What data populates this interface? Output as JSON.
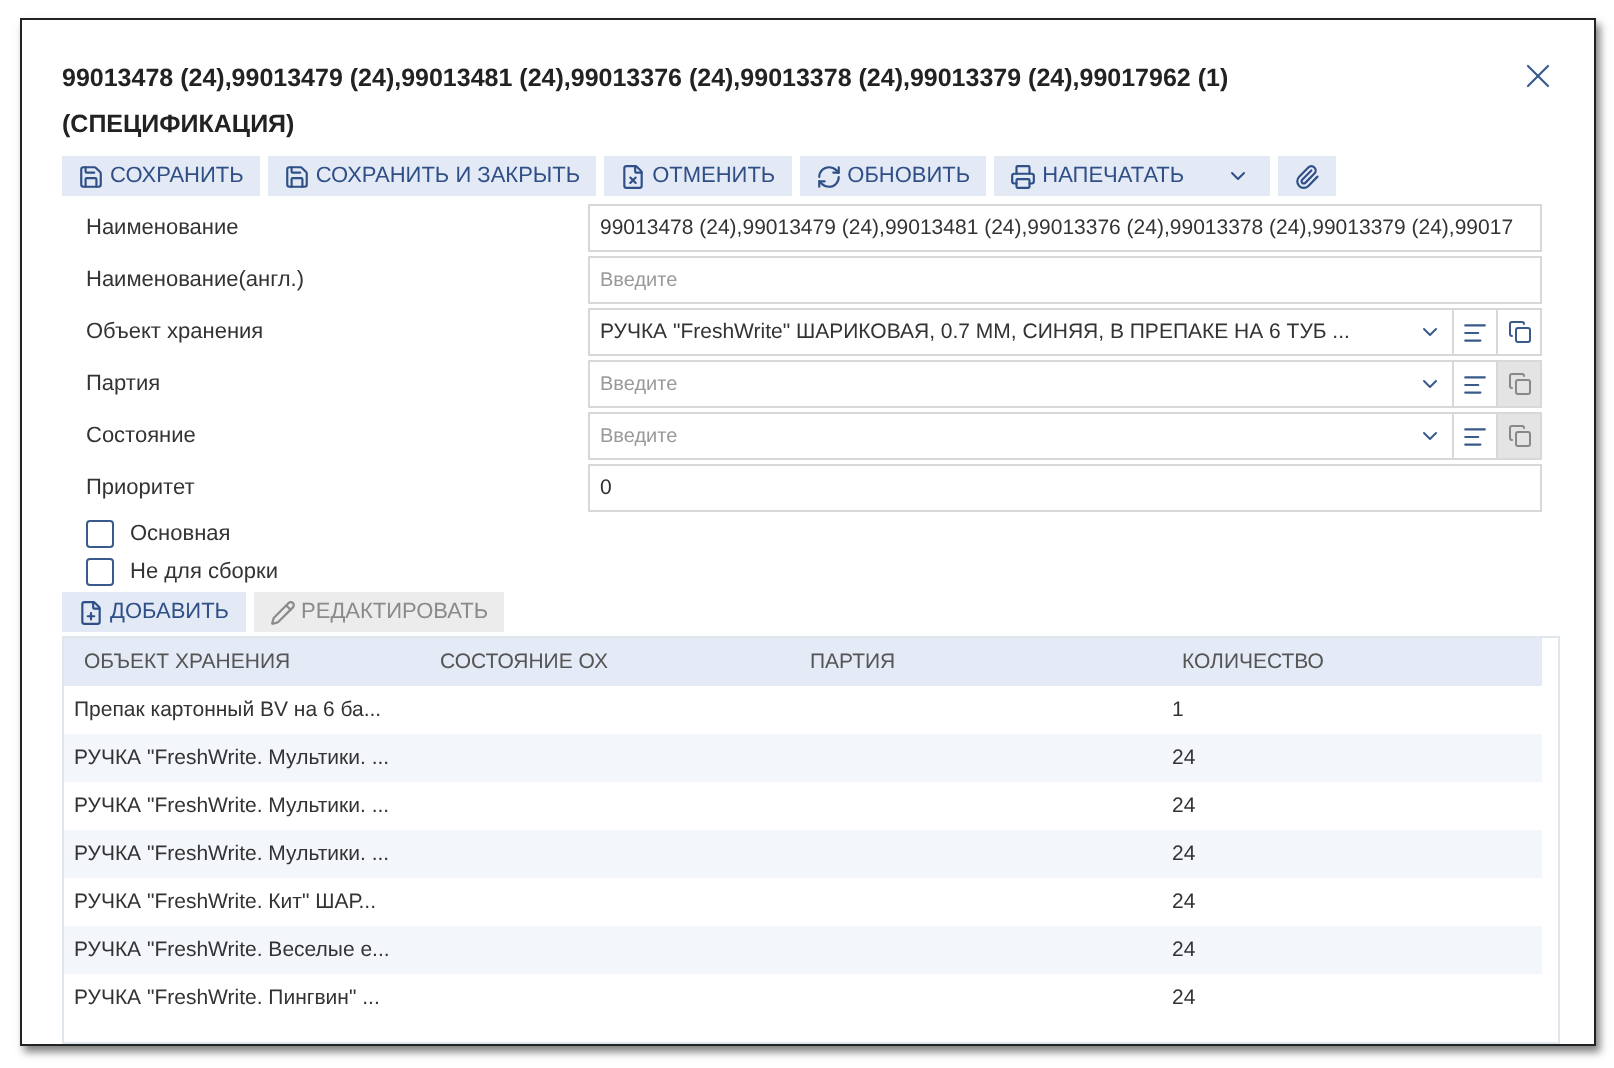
{
  "window": {
    "title": "99013478 (24),99013479 (24),99013481 (24),99013376 (24),99013378 (24),99013379 (24),99017962 (1)",
    "subtitle": "(СПЕЦИФИКАЦИЯ)"
  },
  "toolbar": [
    {
      "kind": "save",
      "label": "СОХРАНИТЬ"
    },
    {
      "kind": "save",
      "label": "СОХРАНИТЬ И ЗАКРЫТЬ"
    },
    {
      "kind": "cancel",
      "label": "ОТМЕНИТЬ"
    },
    {
      "kind": "refresh",
      "label": "ОБНОВИТЬ"
    },
    {
      "kind": "print",
      "label": "НАПЕЧАТАТЬ"
    },
    {
      "kind": "attach"
    }
  ],
  "fields": [
    {
      "kind": "text",
      "label": "Наименование",
      "value": "99013478 (24),99013479 (24),99013481 (24),99013376 (24),99013378 (24),99013379 (24),99017"
    },
    {
      "kind": "text",
      "label": "Наименование(англ.)",
      "placeholder": "Введите"
    },
    {
      "kind": "lookup",
      "label": "Объект хранения",
      "value": "РУЧКА \"FreshWrite\" ШАРИКОВАЯ, 0.7 ММ, СИНЯЯ, В ПРЕПАКЕ НА 6 ТУБ ...",
      "copy_disabled": false
    },
    {
      "kind": "lookup",
      "label": "Партия",
      "placeholder": "Введите",
      "copy_disabled": true
    },
    {
      "kind": "lookup",
      "label": "Состояние",
      "placeholder": "Введите",
      "copy_disabled": true
    },
    {
      "kind": "text",
      "label": "Приоритет",
      "value": "0"
    }
  ],
  "checkboxes": [
    {
      "label": "Основная",
      "checked": false
    },
    {
      "label": "Не для сборки",
      "checked": false
    }
  ],
  "table_toolbar": [
    {
      "kind": "add",
      "label": "ДОБАВИТЬ",
      "disabled": false
    },
    {
      "kind": "edit",
      "label": "РЕДАКТИРОВАТЬ",
      "disabled": true
    }
  ],
  "table": {
    "columns": [
      "ОБЪЕКТ ХРАНЕНИЯ",
      "СОСТОЯНИЕ ОХ",
      "ПАРТИЯ",
      "КОЛИЧЕСТВО"
    ],
    "rows": [
      [
        "Препак картонный BV на 6 ба...",
        "",
        "",
        "1"
      ],
      [
        "РУЧКА \"FreshWrite. Мультики. ...",
        "",
        "",
        "24"
      ],
      [
        "РУЧКА \"FreshWrite. Мультики. ...",
        "",
        "",
        "24"
      ],
      [
        "РУЧКА \"FreshWrite. Мультики. ...",
        "",
        "",
        "24"
      ],
      [
        "РУЧКА \"FreshWrite. Кит\" ШАР...",
        "",
        "",
        "24"
      ],
      [
        "РУЧКА \"FreshWrite. Веселые е...",
        "",
        "",
        "24"
      ],
      [
        "РУЧКА \"FreshWrite. Пингвин\" ...",
        "",
        "",
        "24"
      ]
    ]
  }
}
